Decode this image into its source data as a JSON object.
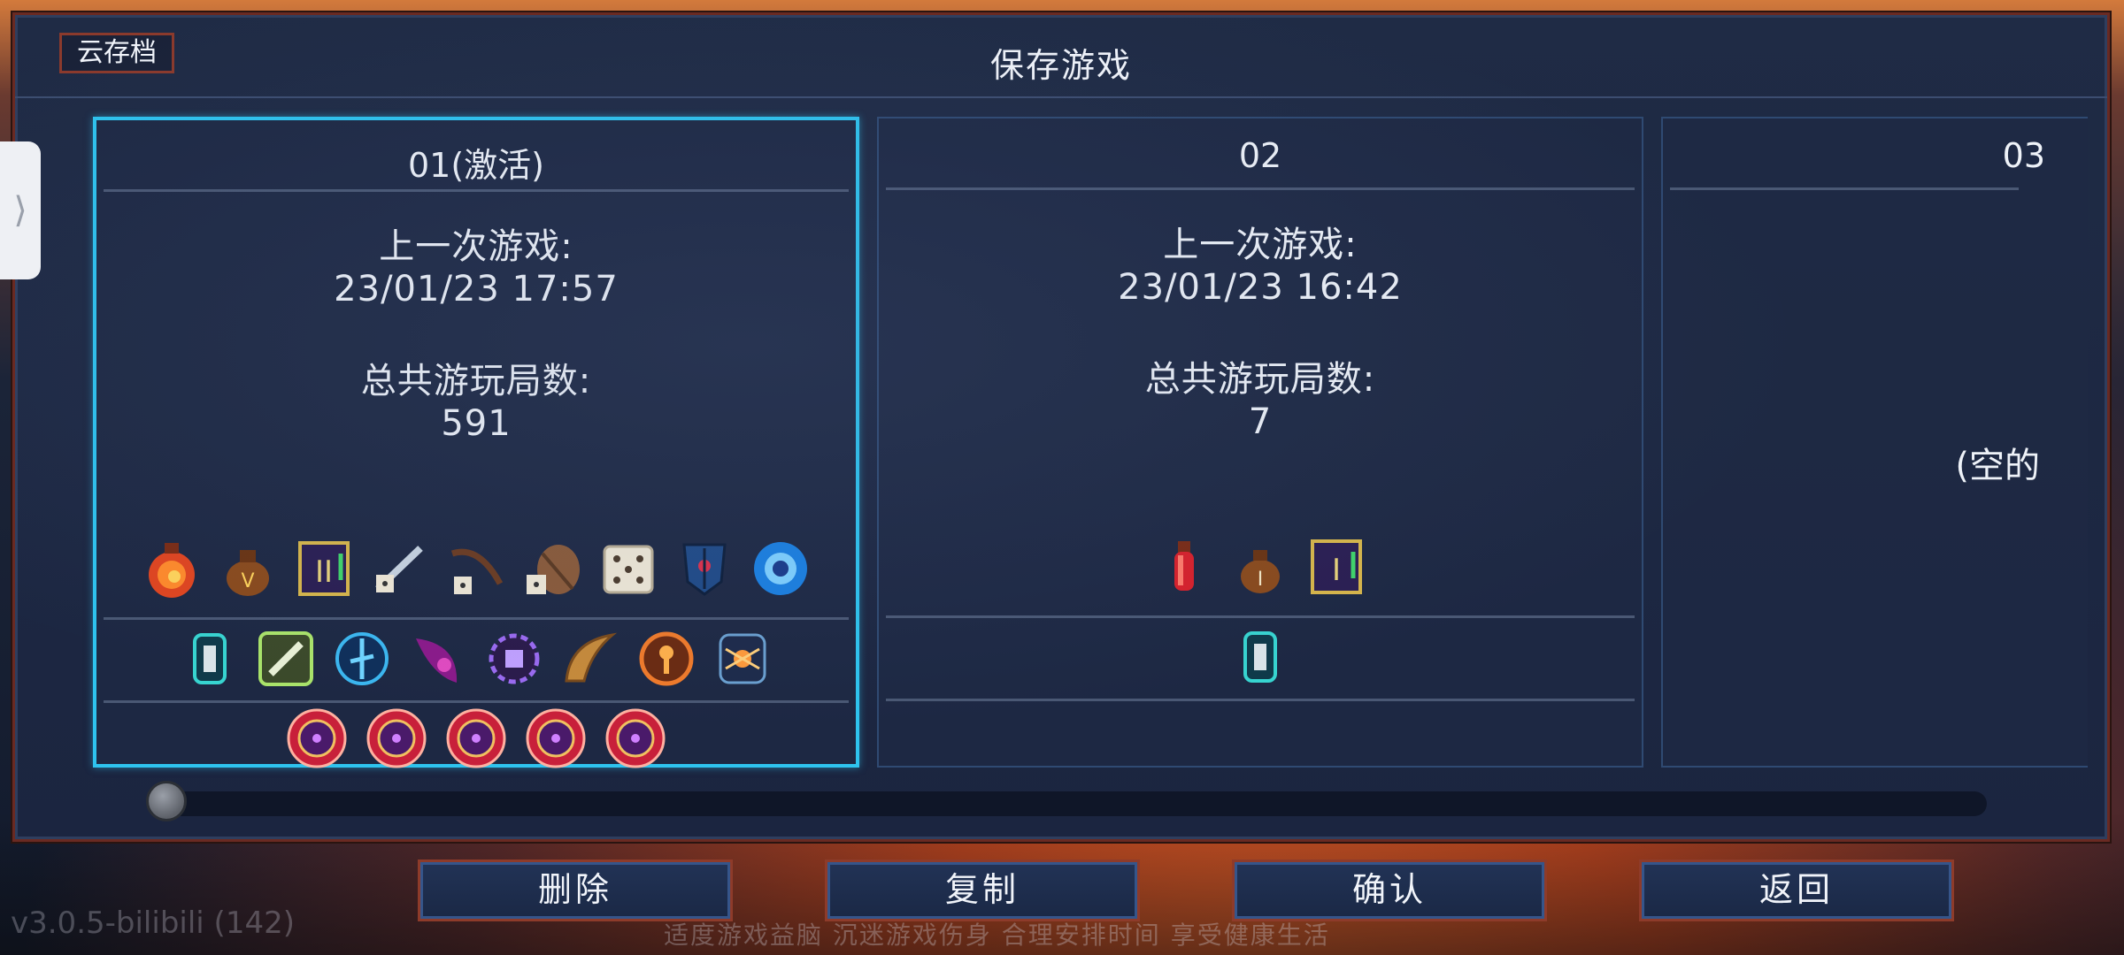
{
  "dialog": {
    "title": "保存游戏",
    "cloud_button": "云存档",
    "side_tab_glyph": "⟩"
  },
  "slots": [
    {
      "name": "01(激活)",
      "active": true,
      "last_played_label": "上一次游戏:",
      "last_played": "23/01/23 17:57",
      "runs_label": "总共游玩局数:",
      "runs": "591",
      "row1_icons": [
        "orange-potion-icon",
        "money-bag-v-icon",
        "scroll-ii-icon",
        "blade-dice-icon",
        "crossbow-dice-icon",
        "armor-dice-icon",
        "white-dice-icon",
        "dark-shield-icon",
        "blue-eye-orb-icon"
      ],
      "row2_icons": [
        "teal-bottle-rune-icon",
        "green-wrench-rune-icon",
        "blue-compass-rune-icon",
        "purple-claw-rune-icon",
        "purple-gear-rune-icon",
        "horn-icon",
        "orange-key-rune-icon",
        "spider-rune-icon"
      ],
      "row3_icons": [
        "boss-cell-icon",
        "boss-cell-icon",
        "boss-cell-icon",
        "boss-cell-icon",
        "boss-cell-icon"
      ]
    },
    {
      "name": "02",
      "active": false,
      "last_played_label": "上一次游戏:",
      "last_played": "23/01/23 16:42",
      "runs_label": "总共游玩局数:",
      "runs": "7",
      "row1_icons": [
        "red-flask-icon",
        "money-bag-i-icon",
        "scroll-i-icon"
      ],
      "row2_icons": [
        "teal-bottle-rune-icon"
      ],
      "row3_icons": []
    },
    {
      "name": "03",
      "active": false,
      "empty_label": "(空的"
    }
  ],
  "scrollbar": {
    "position": 0
  },
  "buttons": {
    "delete": "删除",
    "copy": "复制",
    "confirm": "确认",
    "back": "返回"
  },
  "footer": {
    "version": "v3.0.5-bilibili (142)",
    "notice": "适度游戏益脑 沉迷游戏伤身 合理安排时间 享受健康生活"
  },
  "colors": {
    "active_border": "#2ec3ee",
    "button_border": "#8e3b2a",
    "panel_bg": "#1f2b45"
  }
}
